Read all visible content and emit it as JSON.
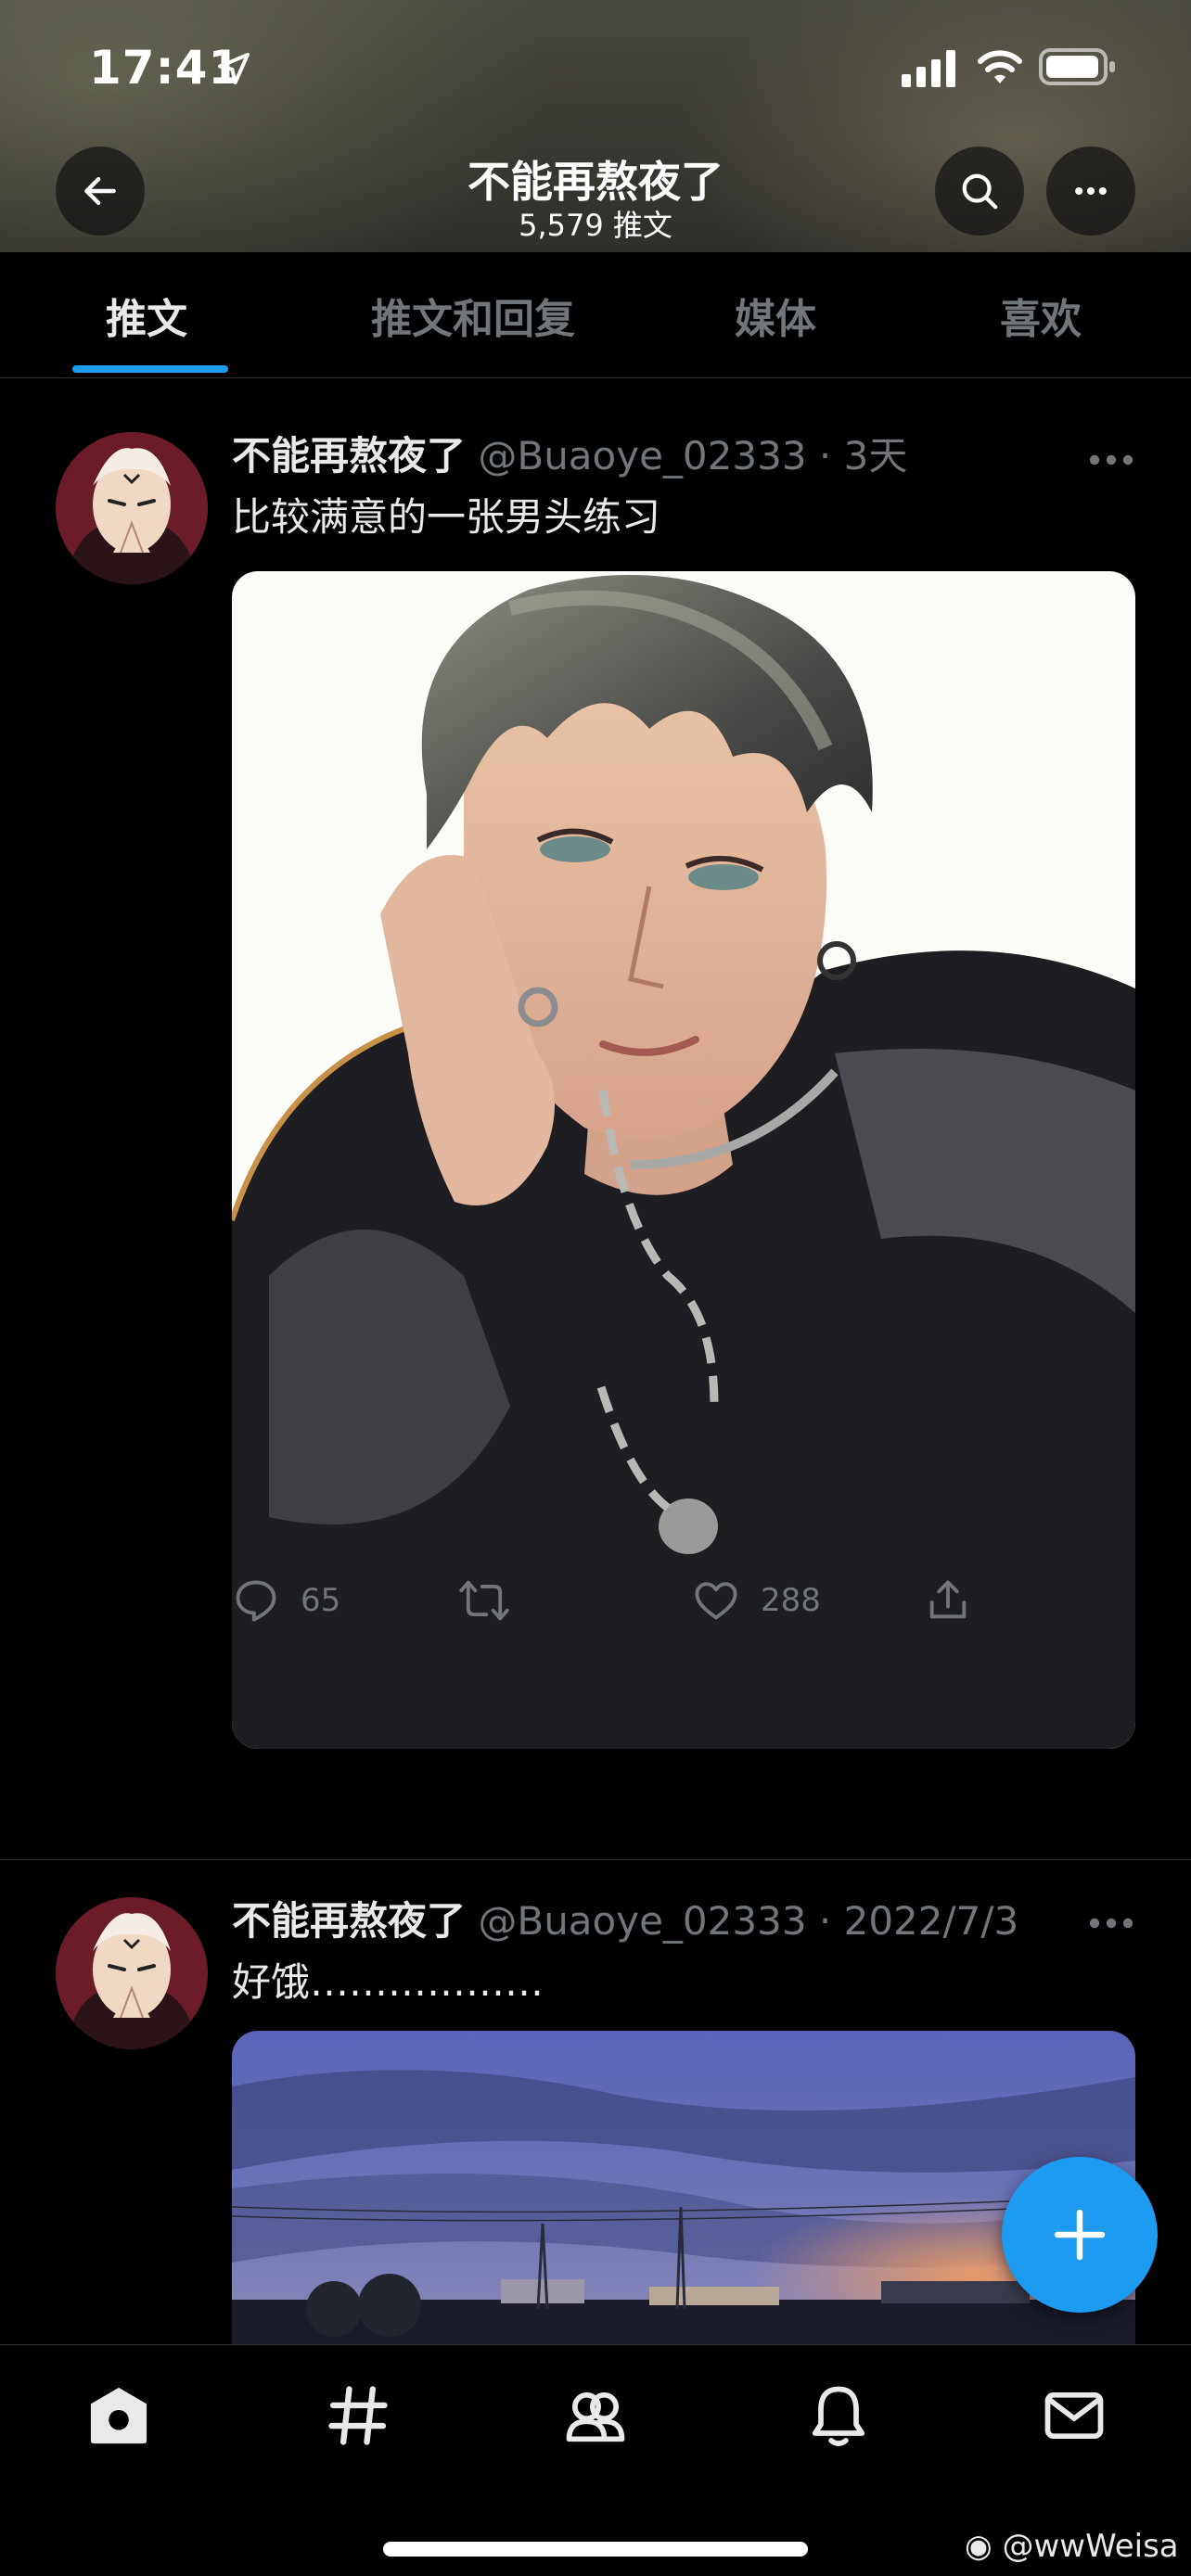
{
  "status_bar": {
    "time": "17:41"
  },
  "profile": {
    "title": "不能再熬夜了",
    "tweet_count": "5,579 推文"
  },
  "tabs": [
    {
      "label": "推文",
      "active": true
    },
    {
      "label": "推文和回复",
      "active": false
    },
    {
      "label": "媒体",
      "active": false
    },
    {
      "label": "喜欢",
      "active": false
    }
  ],
  "tweets": [
    {
      "name": "不能再熬夜了",
      "handle": "@Buaoye_02333",
      "time": "3天",
      "text": "比较满意的一张男头练习",
      "replies": "65",
      "retweets": "",
      "likes": "288"
    },
    {
      "name": "不能再熬夜了",
      "handle": "@Buaoye_02333",
      "time": "2022/7/3",
      "text": "好饿………………"
    }
  ],
  "watermark": "@wwWeisa",
  "colors": {
    "accent": "#1d9bf0",
    "background": "#000000",
    "muted": "#71767b"
  }
}
